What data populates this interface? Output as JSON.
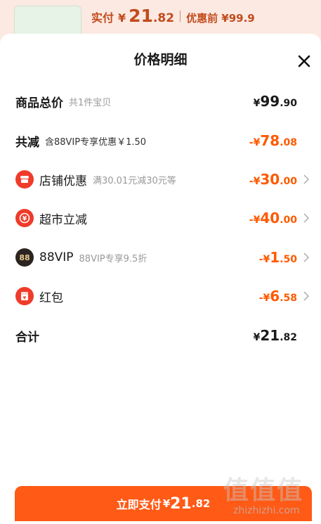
{
  "background": {
    "actual_pay_label": "实付",
    "actual_pay_yen": "¥",
    "actual_pay_int": "21",
    "actual_pay_dec": ".82",
    "original_price_text": "优惠前 ¥99.9"
  },
  "sheet": {
    "title": "价格明细",
    "close_icon": "close-icon"
  },
  "rows": {
    "total": {
      "label": "商品总价",
      "sub": "共1件宝贝",
      "yen": "¥",
      "int": "99",
      "dec": ".90"
    },
    "reduce": {
      "label": "共减",
      "sub": "含88VIP专享优惠￥1.50",
      "yen": "-¥",
      "int": "78",
      "dec": ".08"
    },
    "shop": {
      "label": "店铺优惠",
      "sub": "满30.01元减30元等",
      "yen": "-¥",
      "int": "30",
      "dec": ".00",
      "icon": "shop-coupon-icon"
    },
    "market": {
      "label": "超市立减",
      "sub": "",
      "yen": "-¥",
      "int": "40",
      "dec": ".00",
      "icon": "yen-refresh-icon"
    },
    "vip": {
      "label": "88VIP",
      "sub": "88VIP专享9.5折",
      "yen": "-¥",
      "int": "1",
      "dec": ".50",
      "icon_text": "88"
    },
    "redpacket": {
      "label": "红包",
      "sub": "",
      "yen": "-¥",
      "int": "6",
      "dec": ".58",
      "icon": "red-packet-icon"
    },
    "sum": {
      "label": "合计",
      "yen": "¥",
      "int": "21",
      "dec": ".82"
    }
  },
  "pay_button": {
    "label": "立即支付",
    "yen": "¥",
    "int": "21",
    "dec": ".82"
  },
  "watermark": {
    "logo": "值值值",
    "url": "zhizhizhi.com"
  },
  "colors": {
    "accent": "#ff5a00",
    "button": "#ff5a16",
    "icon_red": "#f03b2a"
  }
}
